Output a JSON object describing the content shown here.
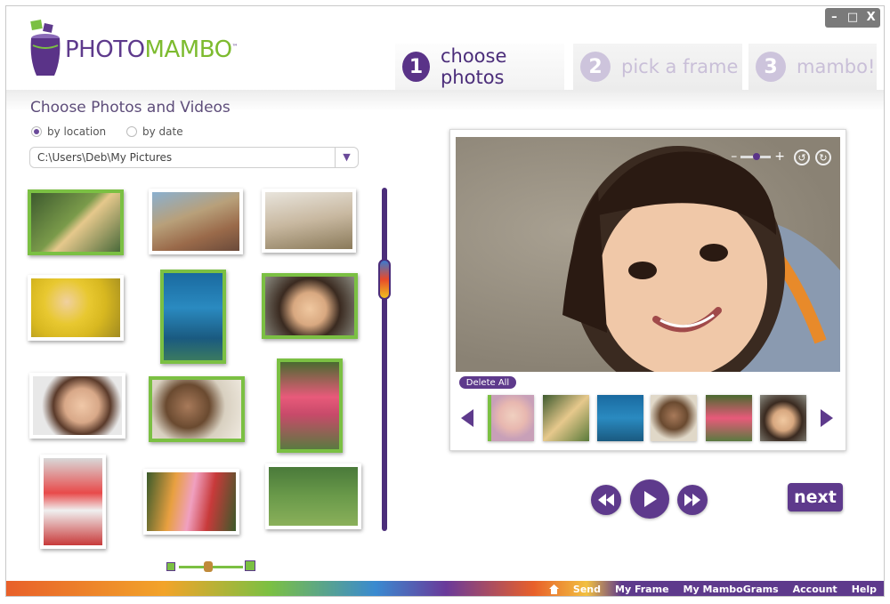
{
  "window_controls": {
    "minimize": "–",
    "maximize": "□",
    "close": "X"
  },
  "logo": {
    "part1": "PHOTO",
    "part2": "MAMBO",
    "tm": "™"
  },
  "steps": [
    {
      "num": "1",
      "label": "choose photos",
      "state": "active"
    },
    {
      "num": "2",
      "label": "pick a frame",
      "state": "inactive"
    },
    {
      "num": "3",
      "label": "mambo!",
      "state": "inactive"
    }
  ],
  "left": {
    "title": "Choose Photos and Videos",
    "radio_location": "by location",
    "radio_date": "by date",
    "path": "C:\\Users\\Deb\\My Pictures"
  },
  "preview": {
    "zoom_minus": "–",
    "zoom_plus": "+",
    "delete_all": "Delete All"
  },
  "buttons": {
    "next": "next"
  },
  "footer": {
    "links": [
      "Send",
      "My Frame",
      "My MamboGrams",
      "Account",
      "Help"
    ]
  },
  "colors": {
    "brand_purple": "#5e3a8c",
    "brand_green": "#7bc043"
  }
}
